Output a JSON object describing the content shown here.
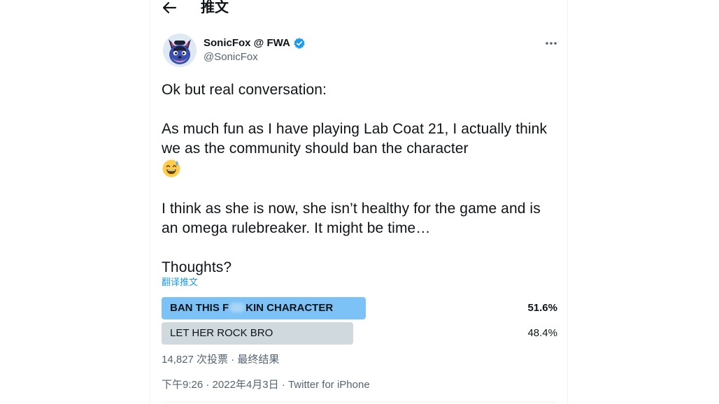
{
  "header": {
    "title": "推文"
  },
  "author": {
    "display_name": "SonicFox @ FWA",
    "handle": "@SonicFox",
    "verified": true
  },
  "tweet": {
    "line1": "Ok but real conversation:",
    "line2": "As much fun as I have playing Lab Coat 21, I actually think we as the community should ban the character",
    "emoji": "grinning-face-with-sweat",
    "line3": "I think as she is now, she isn’t healthy for the game and is an omega rulebreaker. It might be time…",
    "line4": "Thoughts?",
    "translate_label": "翻译推文"
  },
  "poll": {
    "options": [
      {
        "label_before": "BAN THIS F",
        "label_after": "KIN CHARACTER",
        "percent": "51.6%",
        "fraction": 0.516,
        "winner": true,
        "bar_color": "#7cc2f6"
      },
      {
        "label": "LET HER ROCK BRO",
        "percent": "48.4%",
        "fraction": 0.484,
        "winner": false,
        "bar_color": "#cfd9de"
      }
    ],
    "votes": "14,827 次投票",
    "status": "最终结果"
  },
  "meta": {
    "time": "下午9:26",
    "date": "2022年4月3日",
    "source": "Twitter for iPhone"
  },
  "colors": {
    "accent": "#1d9bf0",
    "muted": "#536471",
    "text": "#0f1419"
  }
}
